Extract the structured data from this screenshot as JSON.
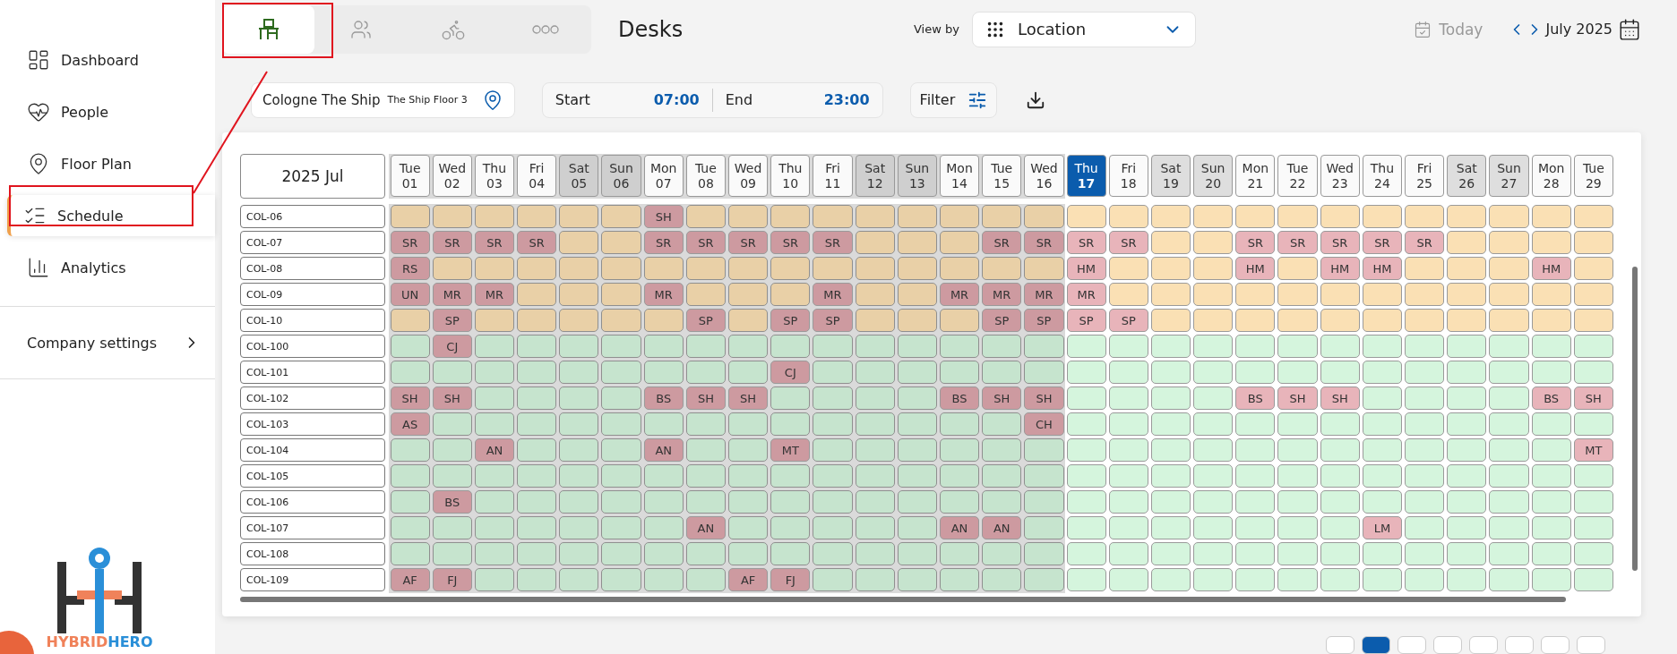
{
  "sidebar": {
    "items": [
      {
        "kind": "dashboard",
        "label": "Dashboard",
        "selected": false
      },
      {
        "kind": "people",
        "label": "People",
        "selected": false
      },
      {
        "kind": "floorplan",
        "label": "Floor Plan",
        "selected": false
      },
      {
        "kind": "schedule",
        "label": "Schedule",
        "selected": true
      },
      {
        "kind": "analytics",
        "label": "Analytics",
        "selected": false
      }
    ],
    "settings": "Company settings",
    "logo": {
      "first": "HYBRID",
      "second": "HERO"
    }
  },
  "resource_tabs": [
    {
      "kind": "desk",
      "selected": true
    },
    {
      "kind": "people",
      "selected": false
    },
    {
      "kind": "vehicle",
      "selected": false
    },
    {
      "kind": "more",
      "selected": false
    }
  ],
  "title": "Desks",
  "view_by": {
    "label": "View by",
    "value": "Location"
  },
  "today": "Today",
  "month": "July 2025",
  "location": {
    "site": "Cologne The Ship",
    "floor": "The Ship Floor 3"
  },
  "time": {
    "start_label": "Start",
    "start": "07:00",
    "end_label": "End",
    "end": "23:00"
  },
  "filter": "Filter",
  "grid": {
    "corner": "2025 Jul",
    "days": [
      {
        "day": "Tue",
        "date": "01",
        "weekend": false,
        "past": true,
        "today": false
      },
      {
        "day": "Wed",
        "date": "02",
        "weekend": false,
        "past": true,
        "today": false
      },
      {
        "day": "Thu",
        "date": "03",
        "weekend": false,
        "past": true,
        "today": false
      },
      {
        "day": "Fri",
        "date": "04",
        "weekend": false,
        "past": true,
        "today": false
      },
      {
        "day": "Sat",
        "date": "05",
        "weekend": true,
        "past": true,
        "today": false
      },
      {
        "day": "Sun",
        "date": "06",
        "weekend": true,
        "past": true,
        "today": false
      },
      {
        "day": "Mon",
        "date": "07",
        "weekend": false,
        "past": true,
        "today": false
      },
      {
        "day": "Tue",
        "date": "08",
        "weekend": false,
        "past": true,
        "today": false
      },
      {
        "day": "Wed",
        "date": "09",
        "weekend": false,
        "past": true,
        "today": false
      },
      {
        "day": "Thu",
        "date": "10",
        "weekend": false,
        "past": true,
        "today": false
      },
      {
        "day": "Fri",
        "date": "11",
        "weekend": false,
        "past": true,
        "today": false
      },
      {
        "day": "Sat",
        "date": "12",
        "weekend": true,
        "past": true,
        "today": false
      },
      {
        "day": "Sun",
        "date": "13",
        "weekend": true,
        "past": true,
        "today": false
      },
      {
        "day": "Mon",
        "date": "14",
        "weekend": false,
        "past": true,
        "today": false
      },
      {
        "day": "Tue",
        "date": "15",
        "weekend": false,
        "past": true,
        "today": false
      },
      {
        "day": "Wed",
        "date": "16",
        "weekend": false,
        "past": true,
        "today": false
      },
      {
        "day": "Thu",
        "date": "17",
        "weekend": false,
        "past": false,
        "today": true
      },
      {
        "day": "Fri",
        "date": "18",
        "weekend": false,
        "past": false,
        "today": false
      },
      {
        "day": "Sat",
        "date": "19",
        "weekend": true,
        "past": false,
        "today": false
      },
      {
        "day": "Sun",
        "date": "20",
        "weekend": true,
        "past": false,
        "today": false
      },
      {
        "day": "Mon",
        "date": "21",
        "weekend": false,
        "past": false,
        "today": false
      },
      {
        "day": "Tue",
        "date": "22",
        "weekend": false,
        "past": false,
        "today": false
      },
      {
        "day": "Wed",
        "date": "23",
        "weekend": false,
        "past": false,
        "today": false
      },
      {
        "day": "Thu",
        "date": "24",
        "weekend": false,
        "past": false,
        "today": false
      },
      {
        "day": "Fri",
        "date": "25",
        "weekend": false,
        "past": false,
        "today": false
      },
      {
        "day": "Sat",
        "date": "26",
        "weekend": true,
        "past": false,
        "today": false
      },
      {
        "day": "Sun",
        "date": "27",
        "weekend": true,
        "past": false,
        "today": false
      },
      {
        "day": "Mon",
        "date": "28",
        "weekend": false,
        "past": false,
        "today": false
      },
      {
        "day": "Tue",
        "date": "29",
        "weekend": false,
        "past": false,
        "today": false
      }
    ],
    "rows": [
      {
        "desk": "COL-06",
        "color": "#fae0b4",
        "cells": [
          null,
          null,
          null,
          null,
          null,
          null,
          "SH",
          null,
          null,
          null,
          null,
          null,
          null,
          null,
          null,
          null,
          null,
          null,
          null,
          null,
          null,
          null,
          null,
          null,
          null,
          null,
          null,
          null,
          null
        ]
      },
      {
        "desk": "COL-07",
        "color": "#fae0b4",
        "cells": [
          "SR",
          "SR",
          "SR",
          "SR",
          null,
          null,
          "SR",
          "SR",
          "SR",
          "SR",
          "SR",
          null,
          null,
          null,
          "SR",
          "SR",
          "SR",
          "SR",
          null,
          null,
          "SR",
          "SR",
          "SR",
          "SR",
          "SR",
          null,
          null,
          null,
          null
        ]
      },
      {
        "desk": "COL-08",
        "color": "#fae0b4",
        "cells": [
          "RS",
          null,
          null,
          null,
          null,
          null,
          null,
          null,
          null,
          null,
          null,
          null,
          null,
          null,
          null,
          null,
          "HM",
          null,
          null,
          null,
          "HM",
          null,
          "HM",
          "HM",
          null,
          null,
          null,
          "HM",
          null
        ]
      },
      {
        "desk": "COL-09",
        "color": "#fae0b4",
        "cells": [
          "UN",
          "MR",
          "MR",
          null,
          null,
          null,
          "MR",
          null,
          null,
          null,
          "MR",
          null,
          null,
          "MR",
          "MR",
          "MR",
          "MR",
          null,
          null,
          null,
          null,
          null,
          null,
          null,
          null,
          null,
          null,
          null,
          null
        ]
      },
      {
        "desk": "COL-10",
        "color": "#fae0b4",
        "cells": [
          null,
          "SP",
          null,
          null,
          null,
          null,
          null,
          "SP",
          null,
          "SP",
          "SP",
          null,
          null,
          null,
          "SP",
          "SP",
          "SP",
          "SP",
          null,
          null,
          null,
          null,
          null,
          null,
          null,
          null,
          null,
          null,
          null
        ]
      },
      {
        "desk": "COL-100",
        "color": "#d5f5dd",
        "cells": [
          null,
          "CJ",
          null,
          null,
          null,
          null,
          null,
          null,
          null,
          null,
          null,
          null,
          null,
          null,
          null,
          null,
          null,
          null,
          null,
          null,
          null,
          null,
          null,
          null,
          null,
          null,
          null,
          null,
          null
        ]
      },
      {
        "desk": "COL-101",
        "color": "#d5f5dd",
        "cells": [
          null,
          null,
          null,
          null,
          null,
          null,
          null,
          null,
          null,
          "CJ",
          null,
          null,
          null,
          null,
          null,
          null,
          null,
          null,
          null,
          null,
          null,
          null,
          null,
          null,
          null,
          null,
          null,
          null,
          null
        ]
      },
      {
        "desk": "COL-102",
        "color": "#d5f5dd",
        "cells": [
          "SH",
          "SH",
          null,
          null,
          null,
          null,
          "BS",
          "SH",
          "SH",
          null,
          null,
          null,
          null,
          "BS",
          "SH",
          "SH",
          null,
          null,
          null,
          null,
          "BS",
          "SH",
          "SH",
          null,
          null,
          null,
          null,
          "BS",
          "SH"
        ]
      },
      {
        "desk": "COL-103",
        "color": "#d5f5dd",
        "cells": [
          "AS",
          null,
          null,
          null,
          null,
          null,
          null,
          null,
          null,
          null,
          null,
          null,
          null,
          null,
          null,
          "CH",
          null,
          null,
          null,
          null,
          null,
          null,
          null,
          null,
          null,
          null,
          null,
          null,
          null
        ]
      },
      {
        "desk": "COL-104",
        "color": "#d5f5dd",
        "cells": [
          null,
          null,
          "AN",
          null,
          null,
          null,
          "AN",
          null,
          null,
          "MT",
          null,
          null,
          null,
          null,
          null,
          null,
          null,
          null,
          null,
          null,
          null,
          null,
          null,
          null,
          null,
          null,
          null,
          null,
          "MT"
        ]
      },
      {
        "desk": "COL-105",
        "color": "#d5f5dd",
        "cells": [
          null,
          null,
          null,
          null,
          null,
          null,
          null,
          null,
          null,
          null,
          null,
          null,
          null,
          null,
          null,
          null,
          null,
          null,
          null,
          null,
          null,
          null,
          null,
          null,
          null,
          null,
          null,
          null,
          null
        ]
      },
      {
        "desk": "COL-106",
        "color": "#d5f5dd",
        "cells": [
          null,
          "BS",
          null,
          null,
          null,
          null,
          null,
          null,
          null,
          null,
          null,
          null,
          null,
          null,
          null,
          null,
          null,
          null,
          null,
          null,
          null,
          null,
          null,
          null,
          null,
          null,
          null,
          null,
          null
        ]
      },
      {
        "desk": "COL-107",
        "color": "#d5f5dd",
        "cells": [
          null,
          null,
          null,
          null,
          null,
          null,
          null,
          "AN",
          null,
          null,
          null,
          null,
          null,
          "AN",
          "AN",
          null,
          null,
          null,
          null,
          null,
          null,
          null,
          null,
          "LM",
          null,
          null,
          null,
          null,
          null
        ]
      },
      {
        "desk": "COL-108",
        "color": "#d5f5dd",
        "cells": [
          null,
          null,
          null,
          null,
          null,
          null,
          null,
          null,
          null,
          null,
          null,
          null,
          null,
          null,
          null,
          null,
          null,
          null,
          null,
          null,
          null,
          null,
          null,
          null,
          null,
          null,
          null,
          null,
          null
        ]
      },
      {
        "desk": "COL-109",
        "color": "#d5f5dd",
        "cells": [
          "AF",
          "FJ",
          null,
          null,
          null,
          null,
          null,
          null,
          "AF",
          "FJ",
          null,
          null,
          null,
          null,
          null,
          null,
          null,
          null,
          null,
          null,
          null,
          null,
          null,
          null,
          null,
          null,
          null,
          null,
          null
        ]
      }
    ]
  }
}
